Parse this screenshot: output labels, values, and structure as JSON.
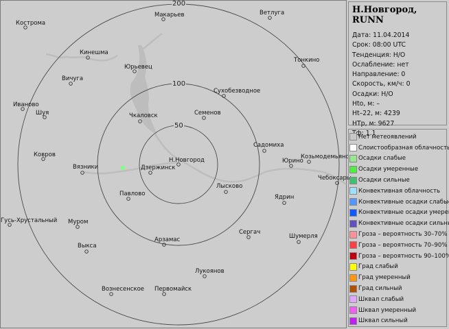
{
  "map": {
    "rings": [
      "50",
      "100",
      "200"
    ],
    "cities": [
      "Кострома",
      "Макарьев",
      "Ветлуга",
      "Кинешма",
      "Юрьевец",
      "Тонкино",
      "Вичуга",
      "Сухобезводное",
      "Иваново",
      "Шуя",
      "Чкаловск",
      "Семенов",
      "Садомиха",
      "Козьмодемьянск",
      "Ковров",
      "Юрино",
      "Н.Новгород",
      "Вязники",
      "Дзержинск",
      "Чебоксары",
      "Лысково",
      "Павлово",
      "Ядрин",
      "Гусь-Хрустальный",
      "Муром",
      "Сергач",
      "Шумерля",
      "Арзамас",
      "Выкса",
      "Лукоянов",
      "Вознесенское",
      "Первомайск"
    ],
    "echo_color": "#80ff80"
  },
  "info": {
    "title": "Н.Новгород, RUNN",
    "lines": [
      "Дата: 11.04.2014",
      "Срок: 08:00 UTC",
      "Тенденция: Н/О",
      "Ослабление: нет",
      "Направление: 0",
      "Скорость, км/ч: 0",
      "Осадки: Н/О",
      "Hto, м:  –",
      "Ht–22, м: 4239",
      "НТр, м: 9627",
      "Тф: 1.1"
    ]
  },
  "legend": [
    {
      "label": "Нет метеоявлений",
      "color": "#c8c8c8"
    },
    {
      "label": "Слоистообразная облачность",
      "color": "#ffffff"
    },
    {
      "label": "Осадки слабые",
      "color": "#98e890"
    },
    {
      "label": "Осадки умеренные",
      "color": "#50f040"
    },
    {
      "label": "Осадки сильные",
      "color": "#40c070"
    },
    {
      "label": "Конвективная облачность",
      "color": "#a0e0ff"
    },
    {
      "label": "Конвективные осадки слабые",
      "color": "#5098ff"
    },
    {
      "label": "Конвективные осадки умерен.",
      "color": "#1058ff"
    },
    {
      "label": "Конвективные осадки сильные",
      "color": "#6050c0"
    },
    {
      "label": "Гроза – вероятность 30–70%",
      "color": "#ff9098"
    },
    {
      "label": "Гроза – вероятность 70–90%",
      "color": "#ff4040"
    },
    {
      "label": "Гроза – вероятность 90–100%",
      "color": "#c00010"
    },
    {
      "label": "Град слабый",
      "color": "#ffff00"
    },
    {
      "label": "Град умеренный",
      "color": "#ff9810"
    },
    {
      "label": "Град сильный",
      "color": "#b05000"
    },
    {
      "label": "Шквал слабый",
      "color": "#e0a8ff"
    },
    {
      "label": "Шквал умеренный",
      "color": "#f060f0"
    },
    {
      "label": "Шквал сильный",
      "color": "#c020f0"
    }
  ]
}
